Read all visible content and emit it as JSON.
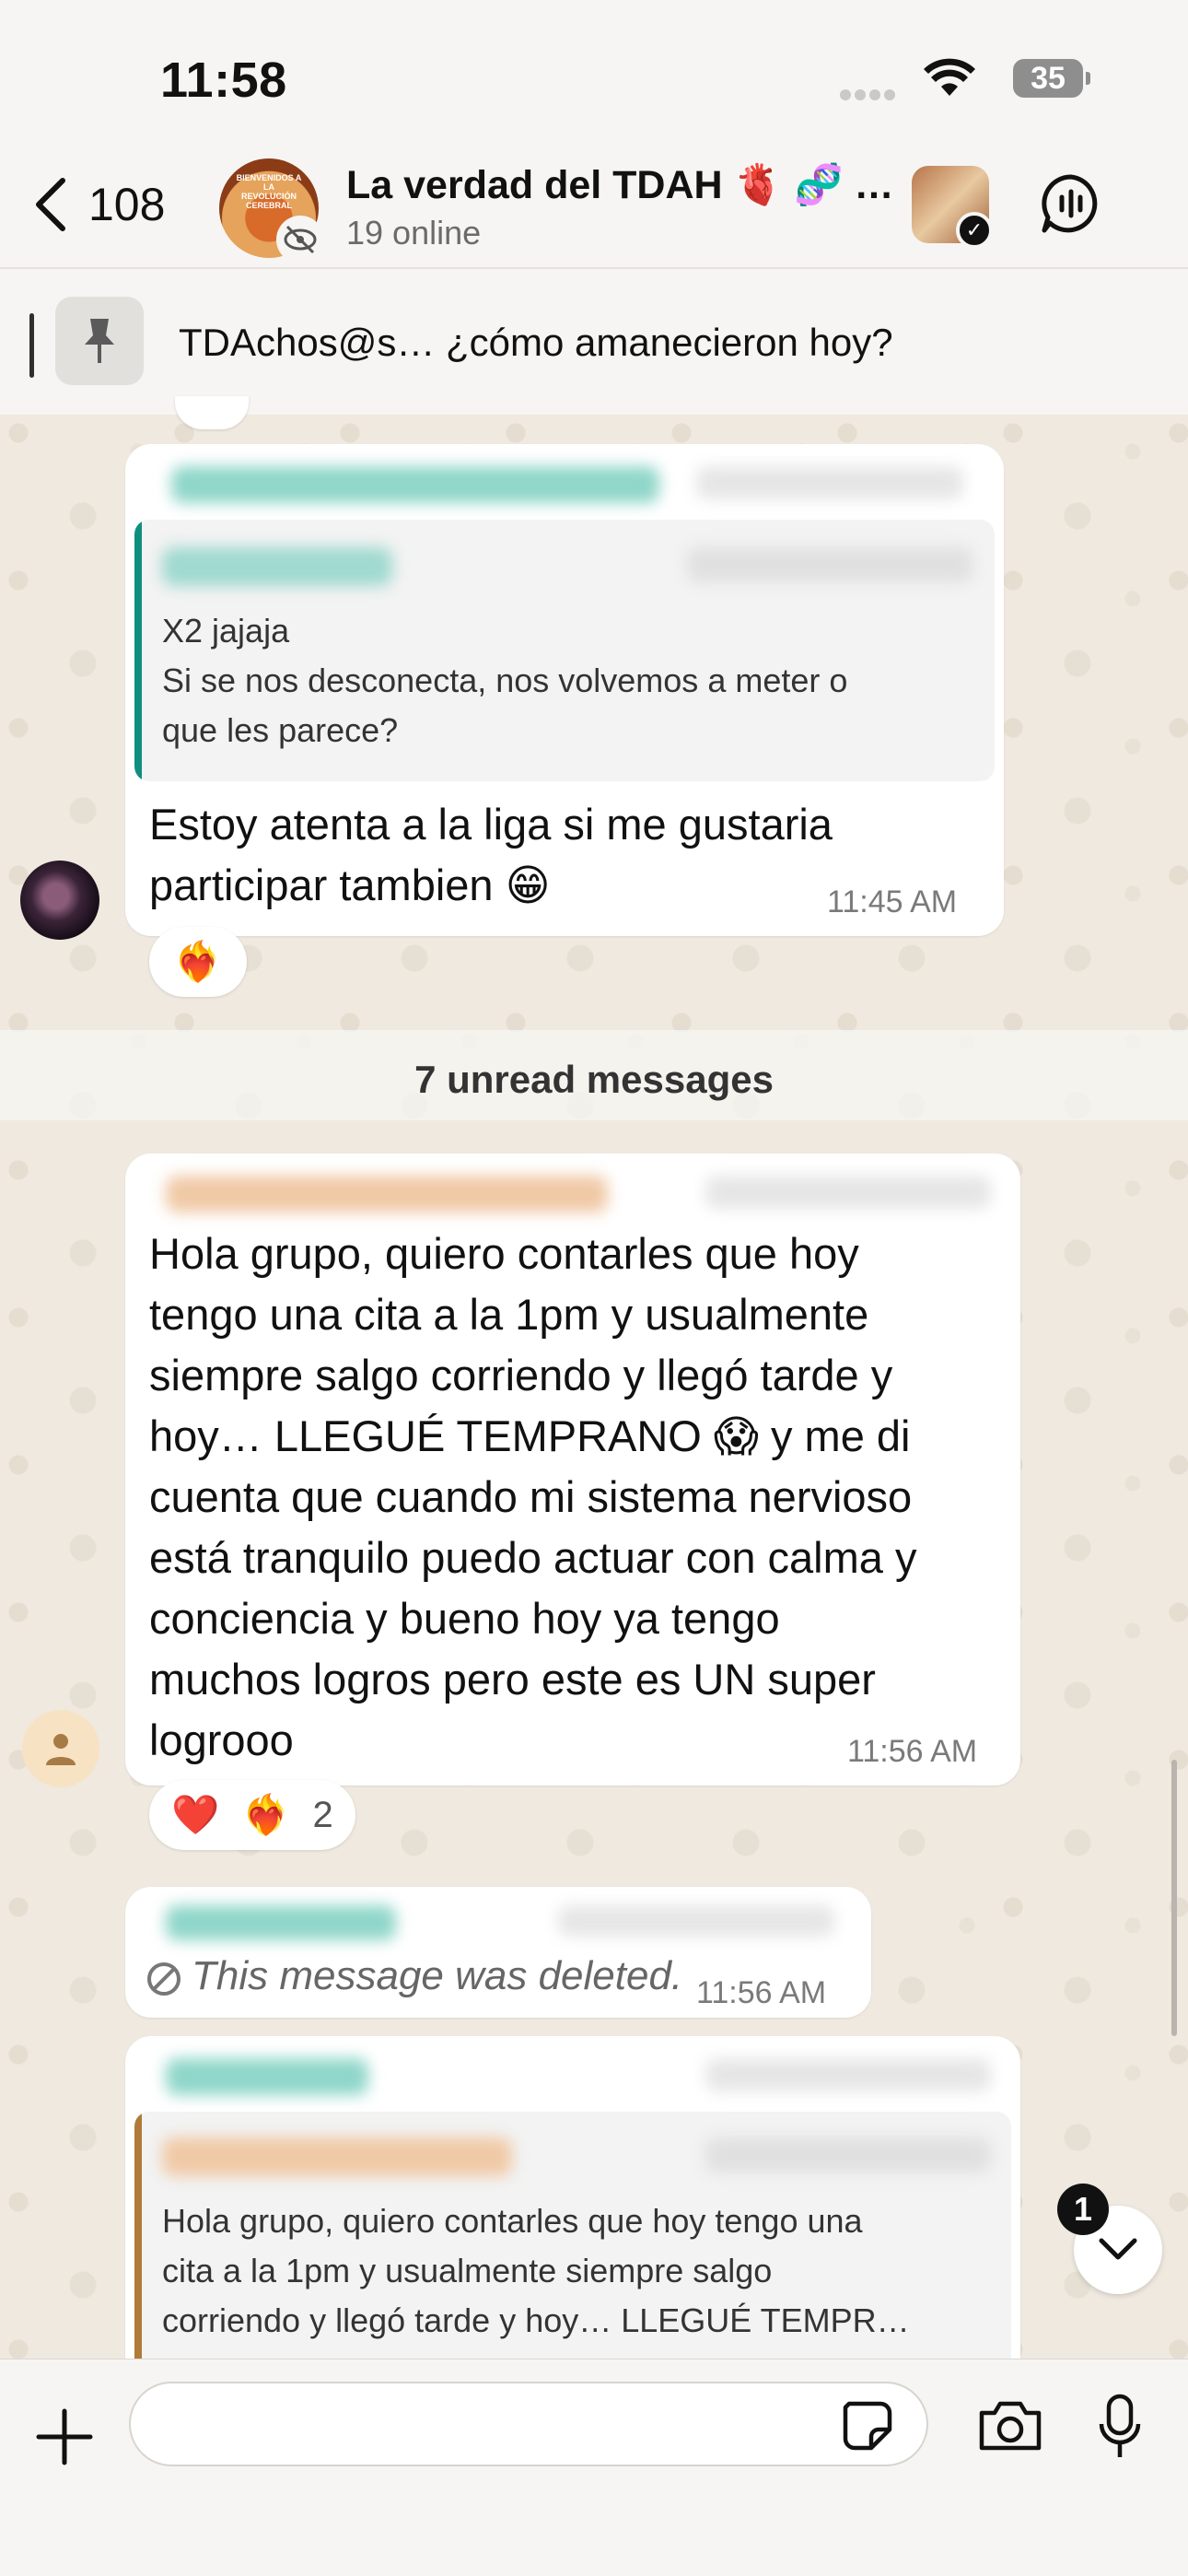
{
  "status_bar": {
    "time": "11:58",
    "battery": "35"
  },
  "header": {
    "back_count": "108",
    "title": "La verdad del TDAH 🫀 🧬 …",
    "subtitle": "19 online",
    "avatar_text": "BIENVENIDOS A LA REVOLUCIÓN CEREBRAL"
  },
  "pinned": {
    "text": "TDAchos@s… ¿cómo amanecieron hoy?"
  },
  "messages": [
    {
      "quote_lines": [
        "X2 jajaja",
        "Si se nos desconecta, nos volvemos a meter o",
        "que les parece?"
      ],
      "text_lines": [
        "Estoy atenta a la liga si me gustaria",
        "participar tambien 😁"
      ],
      "time": "11:45 AM",
      "reaction": "❤️‍🔥"
    },
    {
      "text_lines": [
        "Hola grupo, quiero contarles que hoy",
        "tengo una cita a la 1pm y usualmente",
        "siempre salgo corriendo y llegó tarde y",
        "hoy… LLEGUÉ TEMPRANO 😱 y me di",
        "cuenta que cuando mi sistema nervioso",
        "está tranquilo puedo actuar con calma y",
        "conciencia y bueno hoy ya tengo",
        "muchos logros pero este es UN super",
        "logrooo"
      ],
      "time": "11:56 AM",
      "reactions": [
        "❤️",
        "❤️‍🔥"
      ],
      "reaction_count": "2"
    },
    {
      "deleted_text": "This message was deleted.",
      "time": "11:56 AM"
    },
    {
      "quote_lines": [
        "Hola grupo, quiero contarles que hoy tengo una",
        "cita a la 1pm y usualmente siempre salgo",
        "corriendo y llegó tarde y hoy… LLEGUÉ TEMPR…"
      ]
    }
  ],
  "unread_label": "7 unread messages",
  "scroll_badge": "1",
  "colors": {
    "quote_teal": "#0f8f7f",
    "quote_gold": "#b07a3a",
    "bubble": "#ffffff"
  }
}
